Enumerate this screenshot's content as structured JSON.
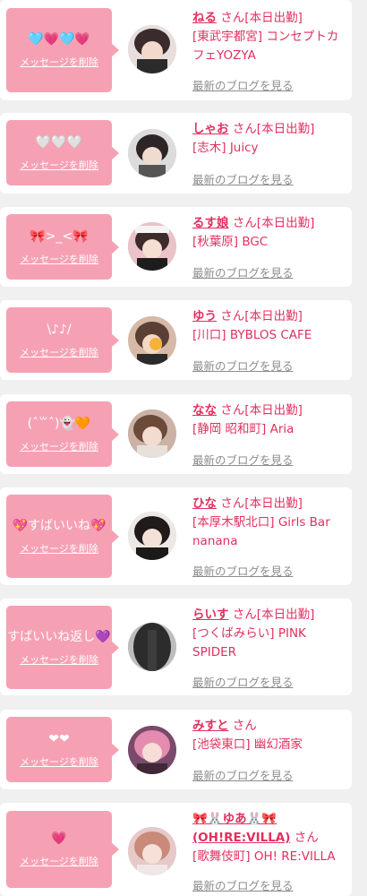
{
  "delete_label": "メッセージを削除",
  "blog_label": "最新のブログを見る",
  "colors": {
    "bubble": "#f6a1b3",
    "name": "#e0305f",
    "link_gray": "#8c8c8c",
    "background": "#f0f0f0"
  },
  "entries": [
    {
      "message": "🩵💗🩵💗",
      "name": "ねる",
      "suffix": "さん[本日出勤]",
      "shop": "[東武宇都宮] コンセプトカフェYOZYA"
    },
    {
      "message": "🤍🤍🤍",
      "name": "しゃお",
      "suffix": "さん[本日出勤]",
      "shop": "[志木] Juicy"
    },
    {
      "message": "🎀>_<🎀",
      "name": "るす娘",
      "suffix": "さん[本日出勤]",
      "shop": "[秋葉原] BGC"
    },
    {
      "message": "\\♪♪/",
      "name": "ゆう",
      "suffix": "さん[本日出勤]",
      "shop": "[川口] BYBLOS CAFE"
    },
    {
      "message": "(ˆ꒳ˆ)👻🧡",
      "name": "なな",
      "suffix": "さん[本日出勤]",
      "shop": "[静岡 昭和町] Aria"
    },
    {
      "message": "💖すばいいね💖",
      "name": "ひな",
      "suffix": "さん[本日出勤]",
      "shop": "[本厚木駅北口] Girls Bar nanana"
    },
    {
      "message": "すばいいね返し💜",
      "name": "らいす",
      "suffix": "さん[本日出勤]",
      "shop": "[つくばみらい] PINK SPIDER"
    },
    {
      "message": "❤❤",
      "name": "みすと",
      "suffix": "さん",
      "shop": "[池袋東口] 幽幻酒家"
    },
    {
      "message": "💗",
      "name": "🎀🐰ゆあ🐰🎀 (OH!RE:VILLA)",
      "suffix": "さん",
      "shop": "[歌舞伎町] OH! RE:VILLA"
    }
  ]
}
